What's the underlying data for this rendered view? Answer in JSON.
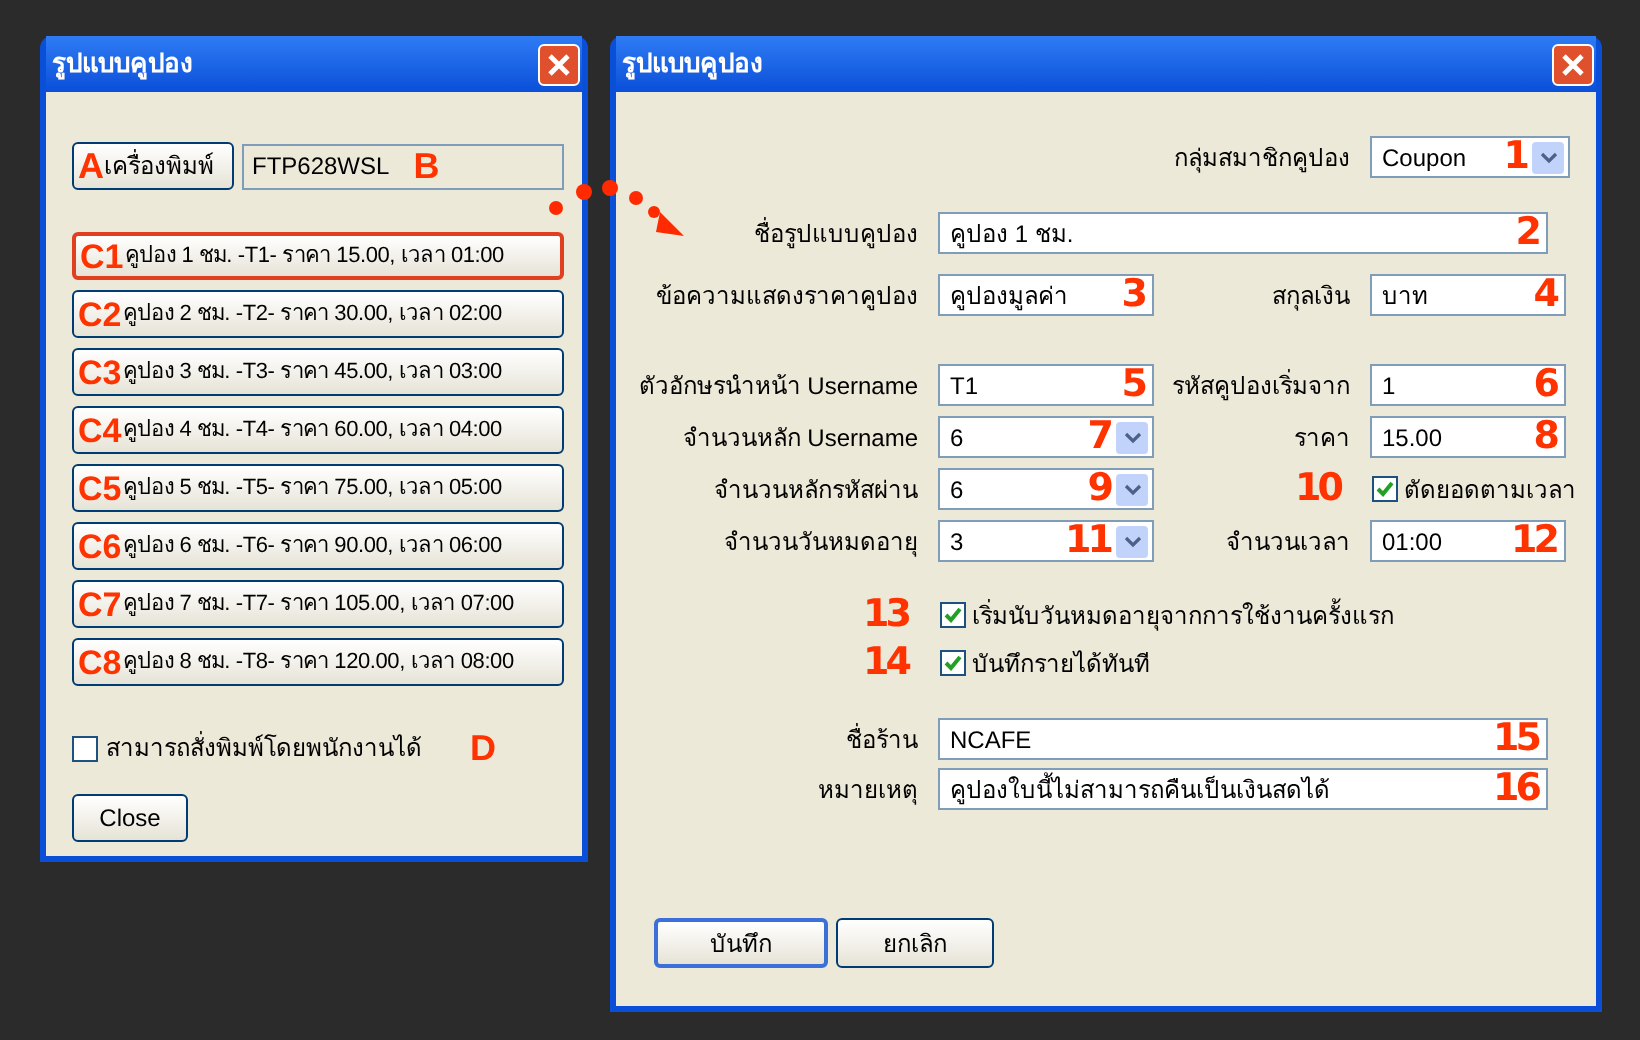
{
  "list_window": {
    "title": "รูปแบบคูปอง",
    "printer_button": {
      "label": "เครื่องพิมพ์",
      "marker": "A"
    },
    "printer_field": {
      "value": "FTP628WSL",
      "marker": "B"
    },
    "coupons": [
      {
        "marker": "C1",
        "label": "คูปอง 1 ชม. -T1- ราคา 15.00, เวลา 01:00",
        "selected": true
      },
      {
        "marker": "C2",
        "label": "คูปอง 2 ชม. -T2- ราคา 30.00, เวลา 02:00",
        "selected": false
      },
      {
        "marker": "C3",
        "label": "คูปอง 3 ชม. -T3- ราคา 45.00, เวลา 03:00",
        "selected": false
      },
      {
        "marker": "C4",
        "label": "คูปอง 4 ชม. -T4- ราคา 60.00, เวลา 04:00",
        "selected": false
      },
      {
        "marker": "C5",
        "label": "คูปอง 5 ชม. -T5- ราคา 75.00, เวลา 05:00",
        "selected": false
      },
      {
        "marker": "C6",
        "label": "คูปอง 6 ชม. -T6- ราคา 90.00, เวลา 06:00",
        "selected": false
      },
      {
        "marker": "C7",
        "label": "คูปอง 7 ชม. -T7- ราคา 105.00, เวลา 07:00",
        "selected": false
      },
      {
        "marker": "C8",
        "label": "คูปอง 8 ชม. -T8- ราคา 120.00, เวลา 08:00",
        "selected": false
      }
    ],
    "staff_print": {
      "label": "สามารถสั่งพิมพ์โดยพนักงานได้",
      "checked": false,
      "marker": "D"
    },
    "close_button": "Close"
  },
  "form_window": {
    "title": "รูปแบบคูปอง",
    "rows": [
      {
        "right": {
          "kind": "combo",
          "label": "กลุ่มสมาชิกคูปอง",
          "value": "Coupon",
          "marker": "1"
        }
      },
      {
        "left": {
          "kind": "wide",
          "label": "ชื่อรูปแบบคูปอง",
          "value": "คูปอง 1 ชม.",
          "marker": "2"
        }
      },
      {
        "left": {
          "kind": "text",
          "label": "ข้อความแสดงราคาคูปอง",
          "value": "คูปองมูลค่า",
          "marker": "3"
        },
        "right": {
          "kind": "text",
          "label": "สกุลเงิน",
          "value": "บาท",
          "marker": "4"
        }
      },
      {
        "left": {
          "kind": "text",
          "label": "ตัวอักษรนำหน้า Username",
          "value": "T1",
          "marker": "5"
        },
        "right": {
          "kind": "text",
          "label": "รหัสคูปองเริ่มจาก",
          "value": "1",
          "marker": "6"
        }
      },
      {
        "left": {
          "kind": "combo",
          "label": "จำนวนหลัก Username",
          "value": "6",
          "marker": "7"
        },
        "right": {
          "kind": "text",
          "label": "ราคา",
          "value": "15.00",
          "marker": "8"
        }
      },
      {
        "left": {
          "kind": "combo",
          "label": "จำนวนหลักรหัสผ่าน",
          "value": "6",
          "marker": "9"
        },
        "right": {
          "kind": "check",
          "label": "ตัดยอดตามเวลา",
          "checked": true,
          "marker": "10"
        }
      },
      {
        "left": {
          "kind": "combo",
          "label": "จำนวนวันหมดอายุ",
          "value": "3",
          "marker": "11"
        },
        "right": {
          "kind": "text",
          "label": "จำนวนเวลา",
          "value": "01:00",
          "marker": "12"
        }
      },
      {
        "left": {
          "kind": "check",
          "label": "เริ่มนับวันหมดอายุจากการใช้งานครั้งแรก",
          "checked": true,
          "marker": "13"
        }
      },
      {
        "left": {
          "kind": "check",
          "label": "บันทึกรายได้ทันที",
          "checked": true,
          "marker": "14"
        }
      },
      {
        "left": {
          "kind": "wide",
          "label": "ชื่อร้าน",
          "value": "NCAFE",
          "marker": "15"
        }
      },
      {
        "left": {
          "kind": "wide",
          "label": "หมายเหตุ",
          "value": "คูปองใบนี้ไม่สามารถคืนเป็นเงินสดได้",
          "marker": "16"
        }
      }
    ],
    "buttons": [
      "บันทึก",
      "ยกเลิก"
    ]
  }
}
